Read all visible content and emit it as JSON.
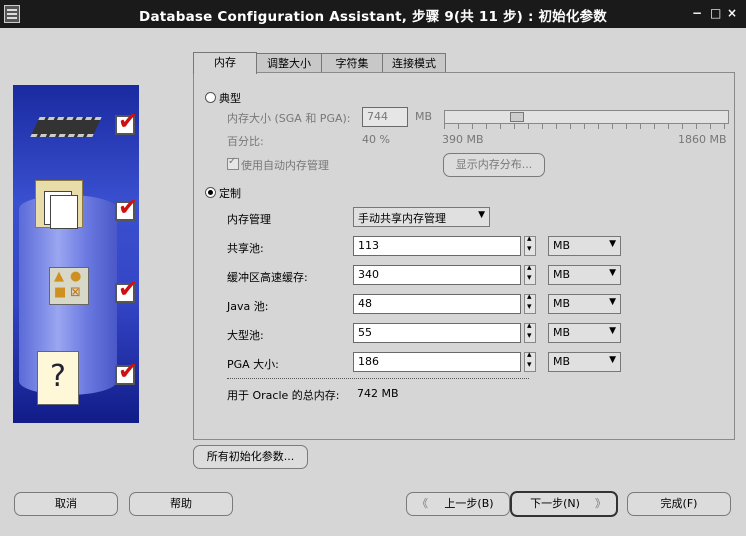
{
  "window": {
    "title": "Database Configuration Assistant, 步骤 9(共 11 步) : 初始化参数",
    "controls": [
      "−",
      "□",
      "×"
    ]
  },
  "tabs": [
    {
      "label": "内存",
      "active": true
    },
    {
      "label": "调整大小",
      "active": false
    },
    {
      "label": "字符集",
      "active": false
    },
    {
      "label": "连接模式",
      "active": false
    }
  ],
  "typical": {
    "label": "典型",
    "memory_size_label": "内存大小 (SGA 和 PGA):",
    "memory_size_value": "744",
    "unit": "MB",
    "percent_label": "百分比:",
    "percent_value": "40 %",
    "slider_min": "390 MB",
    "slider_max": "1860 MB",
    "slider_fraction": 0.24,
    "auto_memory_label": "使用自动内存管理",
    "show_distribution_button": "显示内存分布..."
  },
  "custom": {
    "label": "定制",
    "selected": true,
    "memory_mgmt_label": "内存管理",
    "memory_mgmt_value": "手动共享内存管理",
    "rows": [
      {
        "label": "共享池:",
        "value": "113",
        "unit": "MB"
      },
      {
        "label": "缓冲区高速缓存:",
        "value": "340",
        "unit": "MB"
      },
      {
        "label": "Java 池:",
        "value": "48",
        "unit": "MB"
      },
      {
        "label": "大型池:",
        "value": "55",
        "unit": "MB"
      },
      {
        "label": "PGA 大小:",
        "value": "186",
        "unit": "MB"
      }
    ],
    "total_label": "用于 Oracle 的总内存:",
    "total_value": "742 MB"
  },
  "buttons": {
    "all_params": "所有初始化参数...",
    "cancel": "取消",
    "help": "帮助",
    "back": "上一步(B)",
    "next": "下一步(N)",
    "finish": "完成(F)"
  }
}
